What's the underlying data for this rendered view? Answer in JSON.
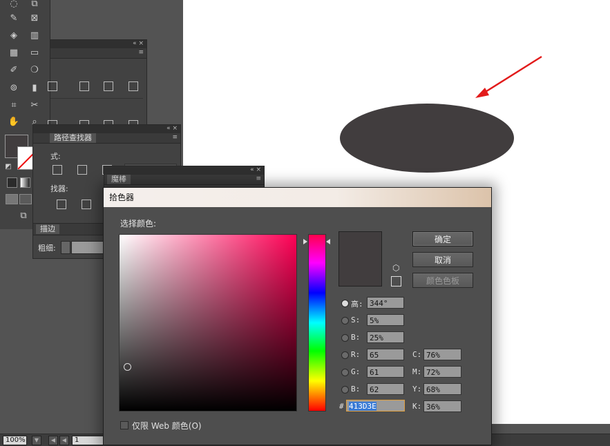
{
  "canvas": {
    "shape_color": "#413D3E",
    "arrow_color": "#e21b1b"
  },
  "statusbar": {
    "zoom": "100%",
    "page": "1"
  },
  "tools": {
    "items": [
      "lasso-icon",
      "artboard-icon",
      "warp-icon",
      "graph-icon",
      "shape-builder-icon",
      "perspective-icon",
      "mesh-icon",
      "gradient-icon",
      "eyedropper-icon",
      "blend-icon",
      "symbol-sprayer-icon",
      "column-graph-icon",
      "artboard-tool-icon",
      "slice-icon",
      "hand-icon",
      "zoom-icon"
    ],
    "fill_color": "#413D3E"
  },
  "align_panel": {
    "title_controls": "«  ×"
  },
  "pathfinder_panel": {
    "tab": "路径查找器",
    "label_modes": "式:",
    "label_pathfinders": "找器:"
  },
  "stroke_panel": {
    "tab": "描边",
    "weight_label": "粗细:"
  },
  "magic_wand_panel": {
    "tab": "魔棒"
  },
  "picker": {
    "title": "拾色器",
    "select_label": "选择颜色:",
    "buttons": {
      "ok": "确定",
      "cancel": "取消",
      "swatches": "颜色色板"
    },
    "fields": {
      "h_label": "高:",
      "h": "344°",
      "s_label": "S:",
      "s": "5%",
      "b_label": "B:",
      "b": "25%",
      "r_label": "R:",
      "r": "65",
      "g_label": "G:",
      "g": "61",
      "bl_label": "B:",
      "bl": "62",
      "c_label": "C:",
      "c": "76%",
      "m_label": "M:",
      "m": "72%",
      "y_label": "Y:",
      "y": "68%",
      "k_label": "K:",
      "k": "36%",
      "hex_label": "#",
      "hex": "413D3E"
    },
    "web_only": "仅限 Web 颜色(O)",
    "current_color": "#413D3E"
  }
}
